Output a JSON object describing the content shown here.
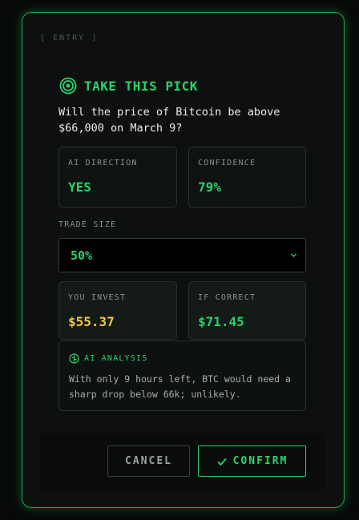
{
  "entry_tag": "[ ENTRY ]",
  "heading": "TAKE THIS PICK",
  "question": "Will the price of Bitcoin be above $66,000 on March 9?",
  "ai_direction": {
    "label": "AI DIRECTION",
    "value": "YES"
  },
  "confidence": {
    "label": "CONFIDENCE",
    "value": "79%"
  },
  "trade_size": {
    "label": "TRADE SIZE",
    "selected": "50%"
  },
  "you_invest": {
    "label": "YOU INVEST",
    "value": "$55.37"
  },
  "if_correct": {
    "label": "IF CORRECT",
    "value": "$71.45"
  },
  "analysis": {
    "title": "AI ANALYSIS",
    "text": "With only 9 hours left, BTC would need a sharp drop below 66k; unlikely."
  },
  "buttons": {
    "cancel": "CANCEL",
    "confirm": "CONFIRM"
  },
  "icons": {
    "heading": "target-icon",
    "analysis": "brain-icon",
    "select": "chevron-down-icon",
    "confirm": "check-icon"
  },
  "colors": {
    "accent": "#27d36c",
    "invest": "#f3c640",
    "background": "#0d100f"
  }
}
